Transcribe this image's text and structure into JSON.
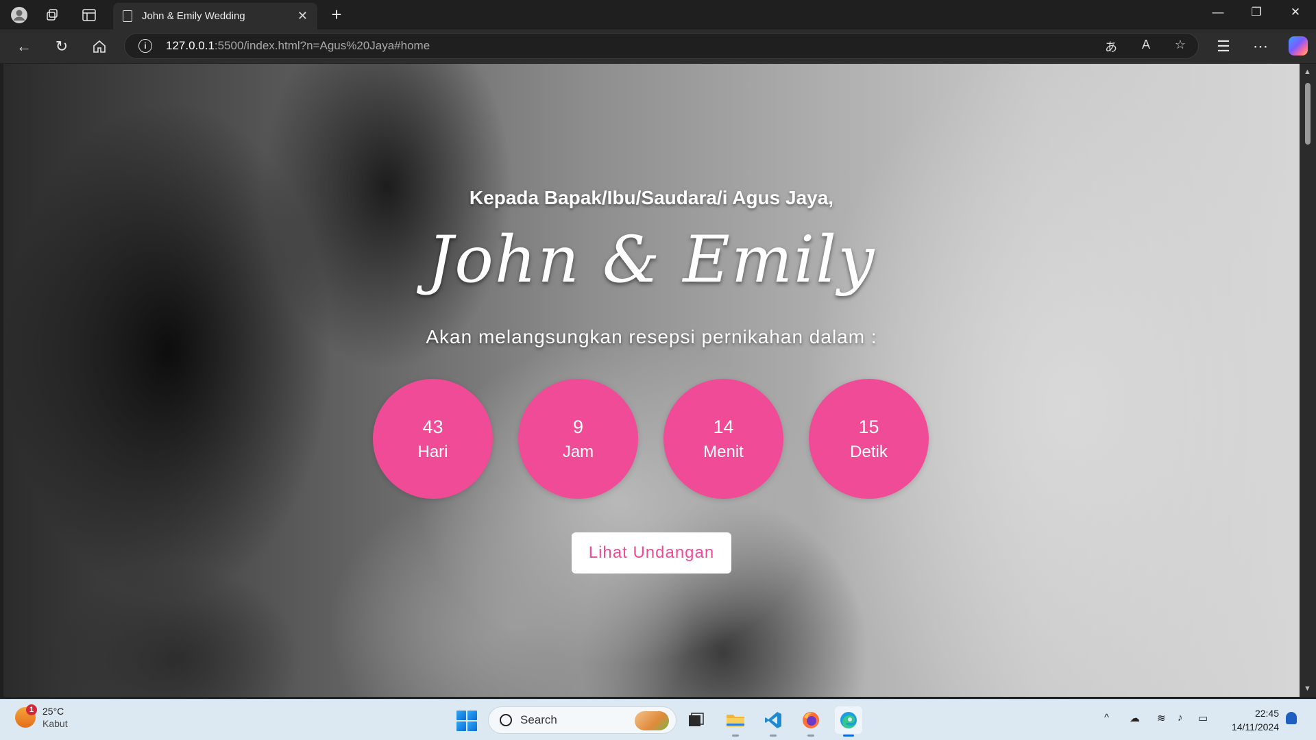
{
  "browser": {
    "tab_title": "John & Emily Wedding",
    "url_host": "127.0.0.1",
    "url_rest": ":5500/index.html?n=Agus%20Jaya#home"
  },
  "page": {
    "greeting": "Kepada Bapak/Ibu/Saudara/i Agus Jaya,",
    "couple": "John & Emily",
    "subtitle": "Akan melangsungkan resepsi pernikahan dalam :",
    "countdown": [
      {
        "value": "43",
        "unit": "Hari"
      },
      {
        "value": "9",
        "unit": "Jam"
      },
      {
        "value": "14",
        "unit": "Menit"
      },
      {
        "value": "15",
        "unit": "Detik"
      }
    ],
    "invite_button": "Lihat Undangan",
    "accent_color": "#f04b96"
  },
  "taskbar": {
    "weather_temp": "25°C",
    "weather_cond": "Kabut",
    "weather_badge": "1",
    "search_label": "Search",
    "time": "22:45",
    "date": "14/11/2024"
  }
}
